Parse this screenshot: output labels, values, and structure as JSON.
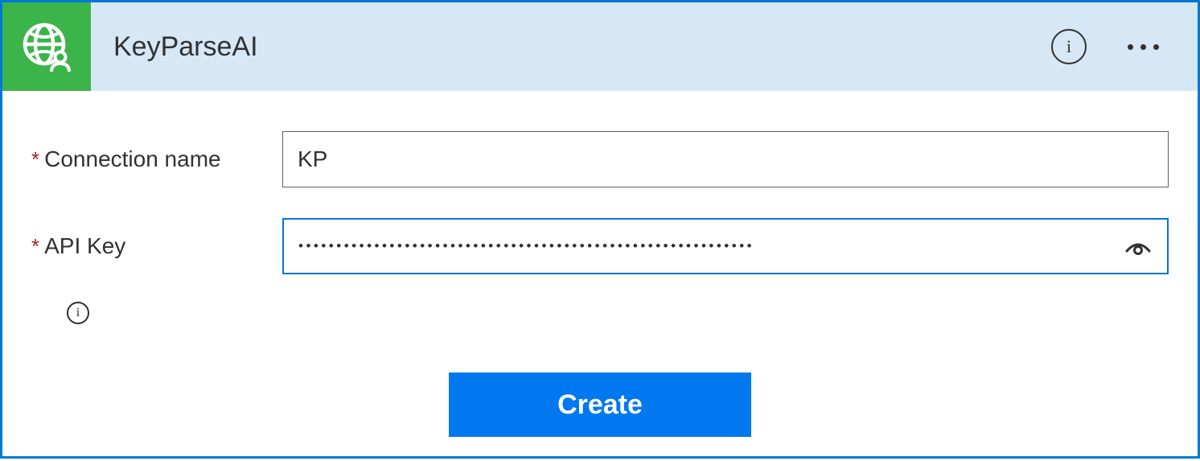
{
  "header": {
    "title": "KeyParseAI"
  },
  "form": {
    "connection_name": {
      "label": "Connection name",
      "value": "KP",
      "required": true
    },
    "api_key": {
      "label": "API Key",
      "value": "••••••••••••••••••••••••••••••••••••••••••••••••••••••••••••",
      "required": true
    }
  },
  "actions": {
    "create_label": "Create"
  }
}
